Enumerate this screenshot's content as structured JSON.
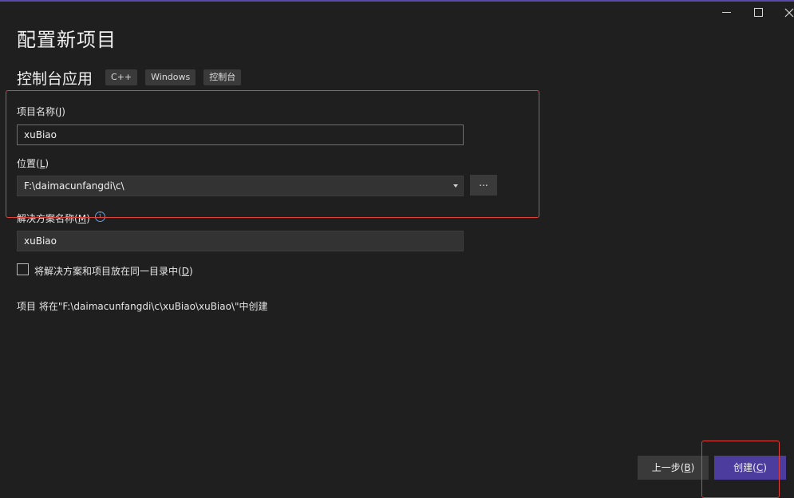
{
  "window": {
    "min_icon": "minimize-icon",
    "max_icon": "maximize-icon",
    "close_icon": "close-icon"
  },
  "header": {
    "title": "配置新项目",
    "subtitle": "控制台应用",
    "tags": [
      "C++",
      "Windows",
      "控制台"
    ]
  },
  "form": {
    "project_name_label": "项目名称",
    "project_name_key": "J",
    "project_name_value": "xuBiao",
    "location_label": "位置",
    "location_key": "L",
    "location_value": "F:\\daimacunfangdi\\c\\",
    "browse_label": "...",
    "solution_name_label": "解决方案名称",
    "solution_name_key": "M",
    "solution_name_value": "xuBiao",
    "same_dir_label": "将解决方案和项目放在同一目录中",
    "same_dir_key": "D",
    "same_dir_checked": false,
    "path_info": "项目 将在\"F:\\daimacunfangdi\\c\\xuBiao\\xuBiao\\\"中创建"
  },
  "footer": {
    "back_label": "上一步",
    "back_key": "B",
    "create_label": "创建",
    "create_key": "C"
  },
  "colors": {
    "background": "#1f1f1f",
    "accent": "#4b3c9e",
    "highlight": "#e0413b",
    "info": "#6aa0e0"
  }
}
